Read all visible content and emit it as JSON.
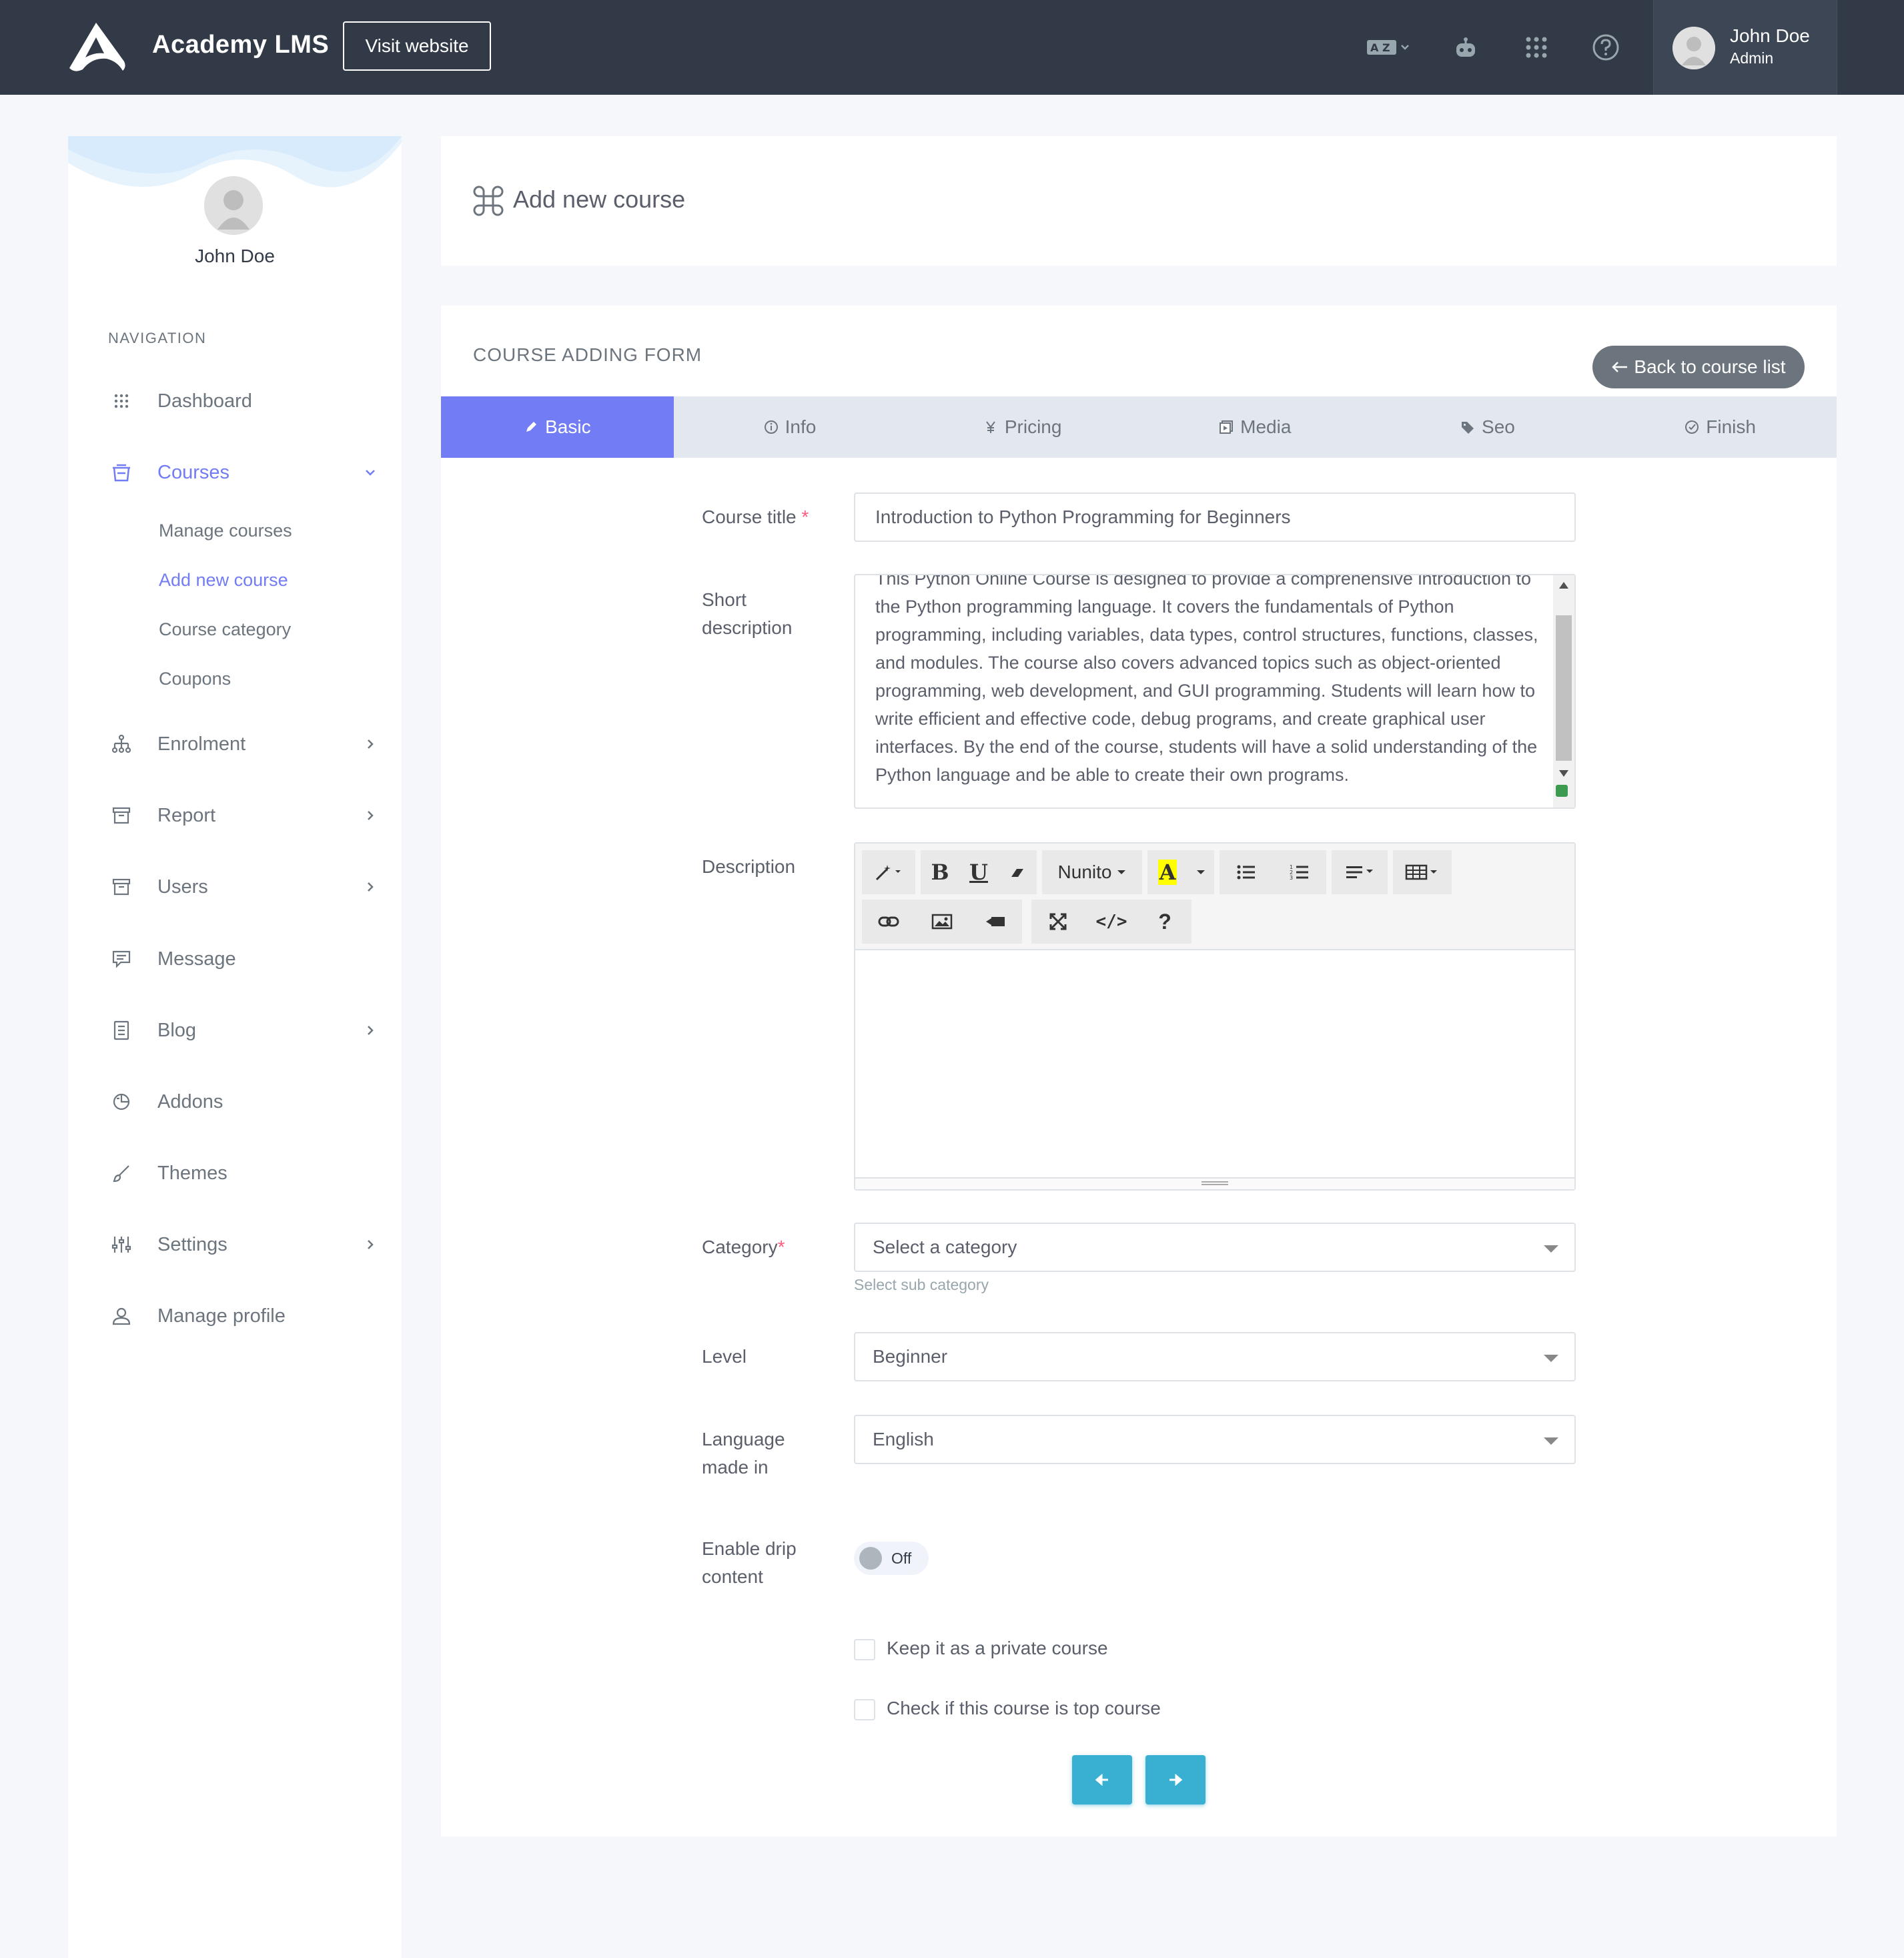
{
  "topbar": {
    "brand": "Academy LMS",
    "visit_label": "Visit website",
    "user_name": "John Doe",
    "user_role": "Admin",
    "icons": [
      "translate-icon",
      "robot-icon",
      "apps-grid-icon",
      "help-icon"
    ]
  },
  "sidebar": {
    "user_name": "John Doe",
    "heading": "NAVIGATION",
    "items": [
      {
        "label": "Dashboard",
        "icon": "grid-icon"
      },
      {
        "label": "Courses",
        "icon": "courses-icon",
        "active": true
      },
      {
        "label": "Enrolment",
        "icon": "sitemap-icon"
      },
      {
        "label": "Report",
        "icon": "archive-icon"
      },
      {
        "label": "Users",
        "icon": "archive-icon"
      },
      {
        "label": "Message",
        "icon": "message-icon"
      },
      {
        "label": "Blog",
        "icon": "document-icon"
      },
      {
        "label": "Addons",
        "icon": "puzzle-icon"
      },
      {
        "label": "Themes",
        "icon": "brush-icon"
      },
      {
        "label": "Settings",
        "icon": "sliders-icon"
      },
      {
        "label": "Manage profile",
        "icon": "user-icon"
      }
    ],
    "courses_sub": [
      "Manage courses",
      "Add new course",
      "Course category",
      "Coupons"
    ]
  },
  "page": {
    "title": "Add new course"
  },
  "form": {
    "heading": "COURSE ADDING FORM",
    "back_label": "Back to course list",
    "tabs": [
      "Basic",
      "Info",
      "Pricing",
      "Media",
      "Seo",
      "Finish"
    ],
    "active_tab": "Basic",
    "fields": {
      "course_title_label": "Course title",
      "course_title_value": "Introduction to Python Programming for Beginners",
      "short_desc_label_1": "Short",
      "short_desc_label_2": "description",
      "short_desc_value": "This Python Online Course is designed to provide a comprehensive introduction to the Python programming language. It covers the fundamentals of Python programming, including variables, data types, control structures, functions, classes, and modules. The course also covers advanced topics such as object-oriented programming, web development, and GUI programming. Students will learn how to write efficient and effective code, debug programs, and create graphical user interfaces. By the end of the course, students will have a solid understanding of the Python language and be able to create their own programs.",
      "description_label": "Description",
      "editor_font": "Nunito",
      "category_label": "Category",
      "category_value": "Select a category",
      "category_hint": "Select sub category",
      "level_label": "Level",
      "level_value": "Beginner",
      "language_label_1": "Language",
      "language_label_2": "made in",
      "language_value": "English",
      "drip_label_1": "Enable drip",
      "drip_label_2": "content",
      "drip_state": "Off",
      "private_label": "Keep it as a private course",
      "top_label": "Check if this course is top course"
    }
  },
  "colors": {
    "topbar": "#313a46",
    "primary": "#727cf5",
    "info": "#39afd1",
    "secondary": "#6c757d"
  }
}
